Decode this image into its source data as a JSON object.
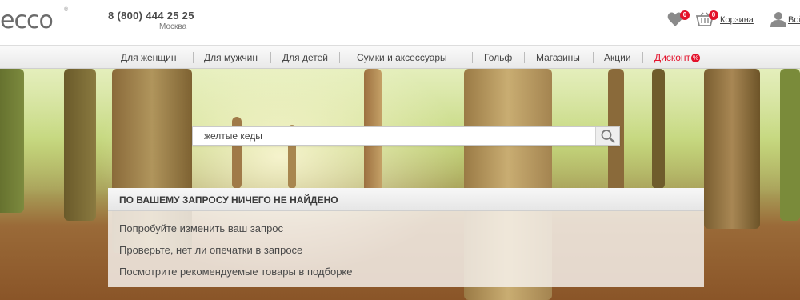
{
  "header": {
    "logo": "ecco",
    "logo_reg": "®",
    "phone": "8 (800) 444 25 25",
    "city": "Москва",
    "wishlist_count": "0",
    "cart_count": "0",
    "cart_label": "Корзина",
    "login_label": "Войти"
  },
  "nav": {
    "items": [
      "Для женщин",
      "Для мужчин",
      "Для детей",
      "Сумки и аксессуары",
      "Гольф",
      "Магазины",
      "Акции",
      "Дисконт"
    ],
    "discount_badge": "%"
  },
  "search": {
    "value": "желтые кеды"
  },
  "results": {
    "title": "ПО ВАШЕМУ ЗАПРОСУ НИЧЕГО НЕ НАЙДЕНО",
    "tips": [
      "Попробуйте изменить ваш запрос",
      "Проверьте, нет ли опечатки в запросе",
      "Посмотрите рекомендуемые товары в подборке"
    ]
  },
  "colors": {
    "accent": "#e3122b",
    "text": "#444444"
  }
}
